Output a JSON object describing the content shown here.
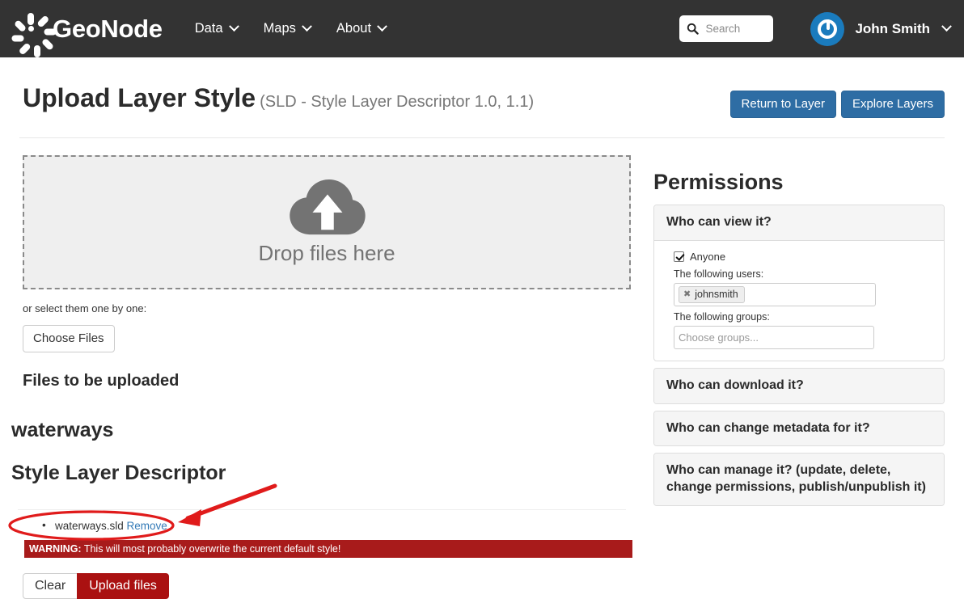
{
  "navbar": {
    "brand": "GeoNode",
    "logo_icon": "geonode-flower-logo-icon",
    "menu": [
      {
        "label": "Data",
        "icon": "chevron-down-icon"
      },
      {
        "label": "Maps",
        "icon": "chevron-down-icon"
      },
      {
        "label": "About",
        "icon": "chevron-down-icon"
      }
    ],
    "search": {
      "placeholder": "Search",
      "icon": "search-icon",
      "value": ""
    },
    "user": {
      "name": "John Smith",
      "avatar_icon": "user-power-avatar-icon",
      "caret_icon": "chevron-down-icon"
    },
    "background_color": "#333333"
  },
  "page": {
    "title": "Upload Layer Style",
    "subtitle": "(SLD - Style Layer Descriptor 1.0, 1.1)",
    "buttons": [
      {
        "label": "Return to Layer"
      },
      {
        "label": "Explore Layers"
      }
    ],
    "accent_color": "#2e6da4"
  },
  "upload": {
    "dropzone": {
      "text": "Drop files here",
      "icon": "cloud-upload-icon"
    },
    "hint": "or select them one by one:",
    "choose_files_label": "Choose Files",
    "files_heading": "Files to be uploaded",
    "layer_name": "waterways",
    "sld_heading": "Style Layer Descriptor",
    "files": [
      {
        "name": "waterways.sld",
        "remove_label": "Remove"
      }
    ],
    "warning": {
      "prefix": "WARNING:",
      "text": "This will most probably overwrite the current default style!",
      "color": "#a81b1b"
    },
    "clear_label": "Clear",
    "upload_label": "Upload files",
    "upload_color": "#aa1111"
  },
  "permissions": {
    "title": "Permissions",
    "sections": [
      {
        "title": "Who can view it?",
        "expanded": true,
        "anyone_label": "Anyone",
        "anyone_checked": true,
        "users_label": "The following users:",
        "users": [
          "johnsmith"
        ],
        "groups_label": "The following groups:",
        "groups_placeholder": "Choose groups..."
      },
      {
        "title": "Who can download it?",
        "expanded": false
      },
      {
        "title": "Who can change metadata for it?",
        "expanded": false
      },
      {
        "title": "Who can manage it? (update, delete, change permissions, publish/unpublish it)",
        "expanded": false
      }
    ]
  },
  "annotations": {
    "highlight_color": "#e01b1b",
    "ellipse_target": "waterways.sld Remove",
    "arrow": "red-arrow-pointing-to-file-entry"
  }
}
